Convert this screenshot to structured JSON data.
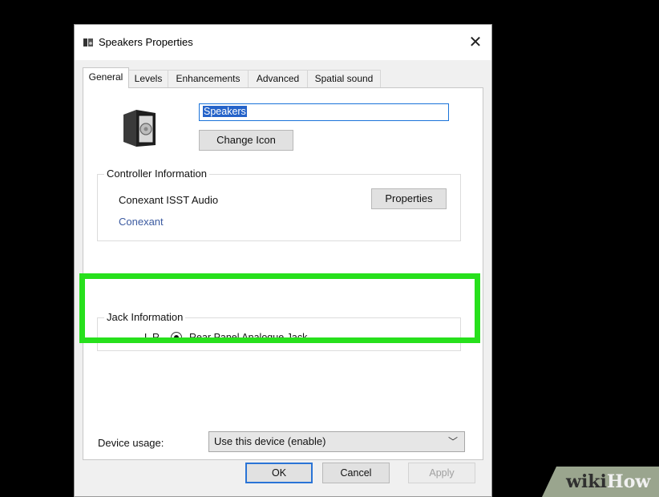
{
  "window": {
    "title": "Speakers Properties",
    "close_label": "✕"
  },
  "tabs": [
    {
      "label": "General",
      "active": true
    },
    {
      "label": "Levels",
      "active": false
    },
    {
      "label": "Enhancements",
      "active": false
    },
    {
      "label": "Advanced",
      "active": false
    },
    {
      "label": "Spatial sound",
      "active": false
    }
  ],
  "general": {
    "device_name_value": "Speakers",
    "change_icon_label": "Change Icon",
    "controller_group": {
      "legend": "Controller Information",
      "controller_name": "Conexant ISST Audio",
      "vendor_link": "Conexant",
      "properties_label": "Properties"
    },
    "jack_group": {
      "legend": "Jack Information",
      "channels": "L R",
      "jack_name": "Rear Panel Analogue Jack",
      "selected": true
    },
    "device_usage": {
      "label": "Device usage:",
      "selected_option": "Use this device (enable)"
    }
  },
  "footer": {
    "ok_label": "OK",
    "cancel_label": "Cancel",
    "apply_label": "Apply",
    "apply_enabled": false
  },
  "watermark": {
    "part1": "wiki",
    "part2": "How"
  },
  "colors": {
    "highlight": "#27e01c",
    "selection": "#2563c9",
    "link": "#3b5aa0",
    "ok_border": "#2a74d6"
  },
  "icons": {
    "title_icon": "speaker-small-icon",
    "device_icon": "speaker-icon",
    "close_icon": "close-icon",
    "dropdown_icon": "chevron-down-icon"
  }
}
